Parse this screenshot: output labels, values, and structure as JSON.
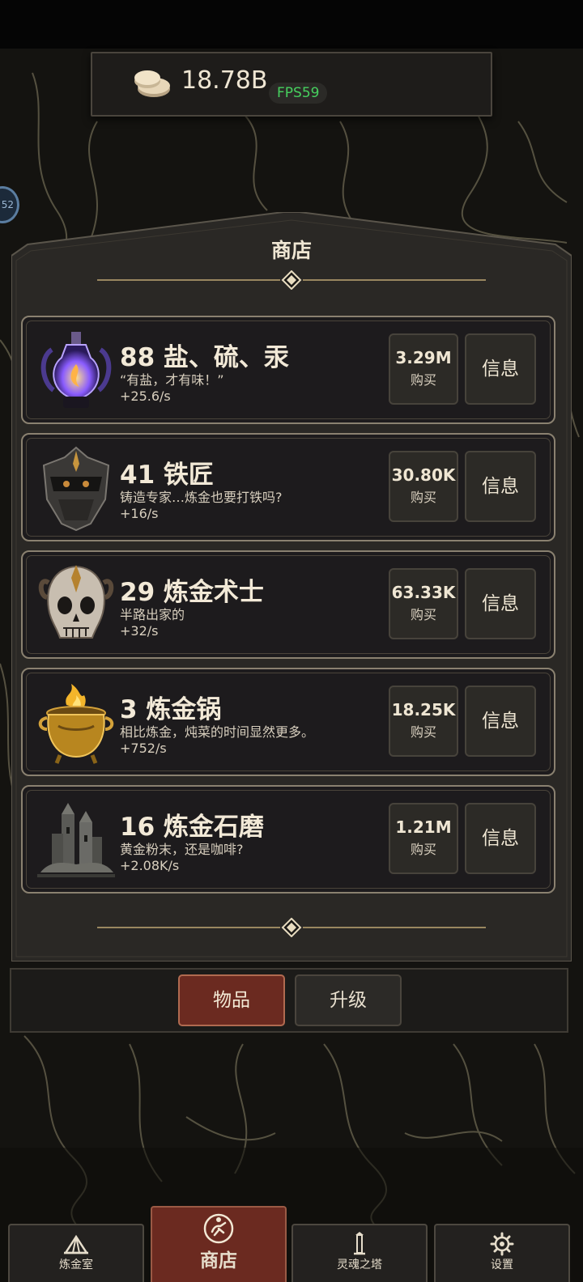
{
  "header": {
    "currency_value": "18.78B",
    "fps_text": "FPS59"
  },
  "side_orb": {
    "label": "52"
  },
  "shop": {
    "title": "商店",
    "items": [
      {
        "name": "88 盐、硫、汞",
        "desc": "“有盐，才有味！”",
        "rate": "+25.6/s",
        "price": "3.29M",
        "buy_label": "购买",
        "info_label": "信息",
        "icon": "potion-icon"
      },
      {
        "name": "41 铁匠",
        "desc": "铸造专家…炼金也要打铁吗?",
        "rate": "+16/s",
        "price": "30.80K",
        "buy_label": "购买",
        "info_label": "信息",
        "icon": "helmet-icon"
      },
      {
        "name": "29 炼金术士",
        "desc": "半路出家的",
        "rate": "+32/s",
        "price": "63.33K",
        "buy_label": "购买",
        "info_label": "信息",
        "icon": "skull-icon"
      },
      {
        "name": "3 炼金锅",
        "desc": "相比炼金，炖菜的时间显然更多。",
        "rate": "+752/s",
        "price": "18.25K",
        "buy_label": "购买",
        "info_label": "信息",
        "icon": "cauldron-icon"
      },
      {
        "name": "16 炼金石磨",
        "desc": "黄金粉末，还是咖啡?",
        "rate": "+2.08K/s",
        "price": "1.21M",
        "buy_label": "购买",
        "info_label": "信息",
        "icon": "tower-icon"
      }
    ]
  },
  "tabs": {
    "items_label": "物品",
    "upgrades_label": "升级"
  },
  "nav": {
    "lab": "炼金室",
    "shop": "商店",
    "tower": "灵魂之塔",
    "settings": "设置"
  },
  "colors": {
    "accent": "#6b2a20",
    "gold": "#c9b07a",
    "fps_green": "#46d05e"
  }
}
